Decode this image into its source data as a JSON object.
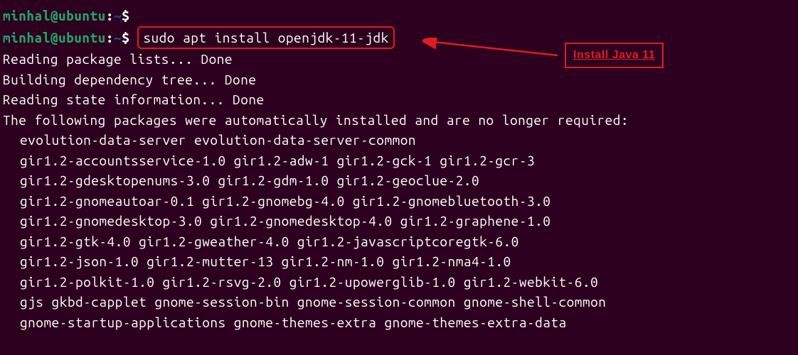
{
  "prompts": [
    {
      "user": "minhal",
      "host": "ubuntu",
      "path": "~",
      "command": ""
    },
    {
      "user": "minhal",
      "host": "ubuntu",
      "path": "~",
      "command": "sudo apt install openjdk-11-jdk"
    }
  ],
  "output": [
    "Reading package lists... Done",
    "Building dependency tree... Done",
    "Reading state information... Done",
    "The following packages were automatically installed and are no longer required:"
  ],
  "packages": [
    "evolution-data-server evolution-data-server-common",
    "gir1.2-accountsservice-1.0 gir1.2-adw-1 gir1.2-gck-1 gir1.2-gcr-3",
    "gir1.2-gdesktopenums-3.0 gir1.2-gdm-1.0 gir1.2-geoclue-2.0",
    "gir1.2-gnomeautoar-0.1 gir1.2-gnomebg-4.0 gir1.2-gnomebluetooth-3.0",
    "gir1.2-gnomedesktop-3.0 gir1.2-gnomedesktop-4.0 gir1.2-graphene-1.0",
    "gir1.2-gtk-4.0 gir1.2-gweather-4.0 gir1.2-javascriptcoregtk-6.0",
    "gir1.2-json-1.0 gir1.2-mutter-13 gir1.2-nm-1.0 gir1.2-nma4-1.0",
    "gir1.2-polkit-1.0 gir1.2-rsvg-2.0 gir1.2-upowerglib-1.0 gir1.2-webkit-6.0",
    "gjs gkbd-capplet gnome-session-bin gnome-session-common gnome-shell-common",
    "gnome-startup-applications gnome-themes-extra gnome-themes-extra-data"
  ],
  "annotation": {
    "label": "Install Java 11"
  }
}
